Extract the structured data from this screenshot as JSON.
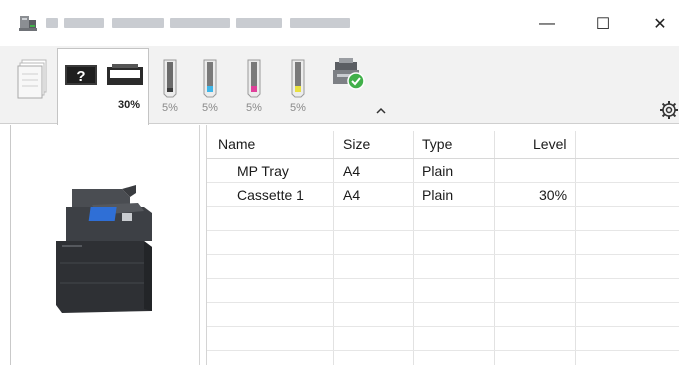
{
  "window": {
    "icons": {
      "app": "printer-app-icon",
      "minimize": "minimize-icon",
      "maximize": "maximize-icon",
      "close": "close-icon"
    },
    "minimize_glyph": "—",
    "maximize_glyph": "☐",
    "close_glyph": "✕"
  },
  "toolbar": {
    "active_tab_percent": "30%",
    "toners": [
      {
        "color_name": "black",
        "color": "#555555",
        "percent": "5%"
      },
      {
        "color_name": "cyan",
        "color": "#3fb6e8",
        "percent": "5%"
      },
      {
        "color_name": "magenta",
        "color": "#e0409a",
        "percent": "5%"
      },
      {
        "color_name": "yellow",
        "color": "#e8e040",
        "percent": "5%"
      }
    ],
    "collapse_glyph": "ᨓ",
    "settings_icon": "gear-icon"
  },
  "table": {
    "columns": [
      "Name",
      "Size",
      "Type",
      "Level"
    ],
    "rows": [
      {
        "name": "MP Tray",
        "size": "A4",
        "type": "Plain",
        "level": ""
      },
      {
        "name": "Cassette 1",
        "size": "A4",
        "type": "Plain",
        "level": "30%"
      }
    ]
  }
}
